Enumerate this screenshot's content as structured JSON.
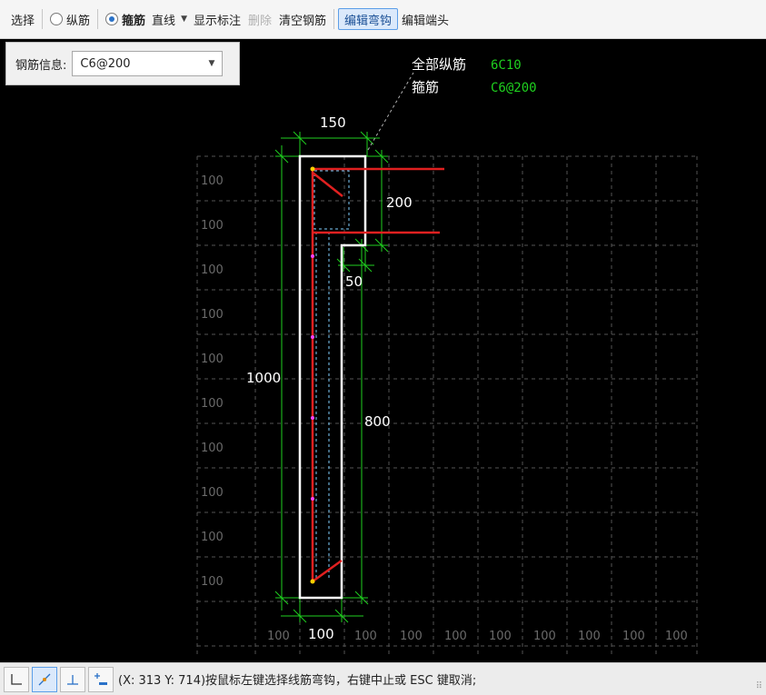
{
  "toolbar": {
    "select": "选择",
    "longitudinal": "纵筋",
    "stirrup": "箍筋",
    "line_type": "直线",
    "show_dims": "显示标注",
    "delete": "删除",
    "clear": "清空钢筋",
    "edit_hook": "编辑弯钩",
    "edit_end": "编辑端头"
  },
  "info": {
    "label": "钢筋信息:",
    "value": "C6@200"
  },
  "legend": {
    "long_label": "全部纵筋",
    "long_value": "6C10",
    "stir_label": "箍筋",
    "stir_value": "C6@200"
  },
  "dims": {
    "top": "150",
    "right_upper": "200",
    "step": "50",
    "left_total": "1000",
    "right_lower": "800",
    "bottom": "100"
  },
  "grid_label": "100",
  "status": {
    "text": "(X: 313 Y: 714)按鼠标左键选择线筋弯钩，右键中止或 ESC 键取消;"
  },
  "colors": {
    "canvas": "#000000",
    "section": "#ffffff",
    "dimension": "#1fd11f",
    "rebar": "#e02020",
    "grid": "#555555",
    "legend_value": "#1fd11f"
  }
}
